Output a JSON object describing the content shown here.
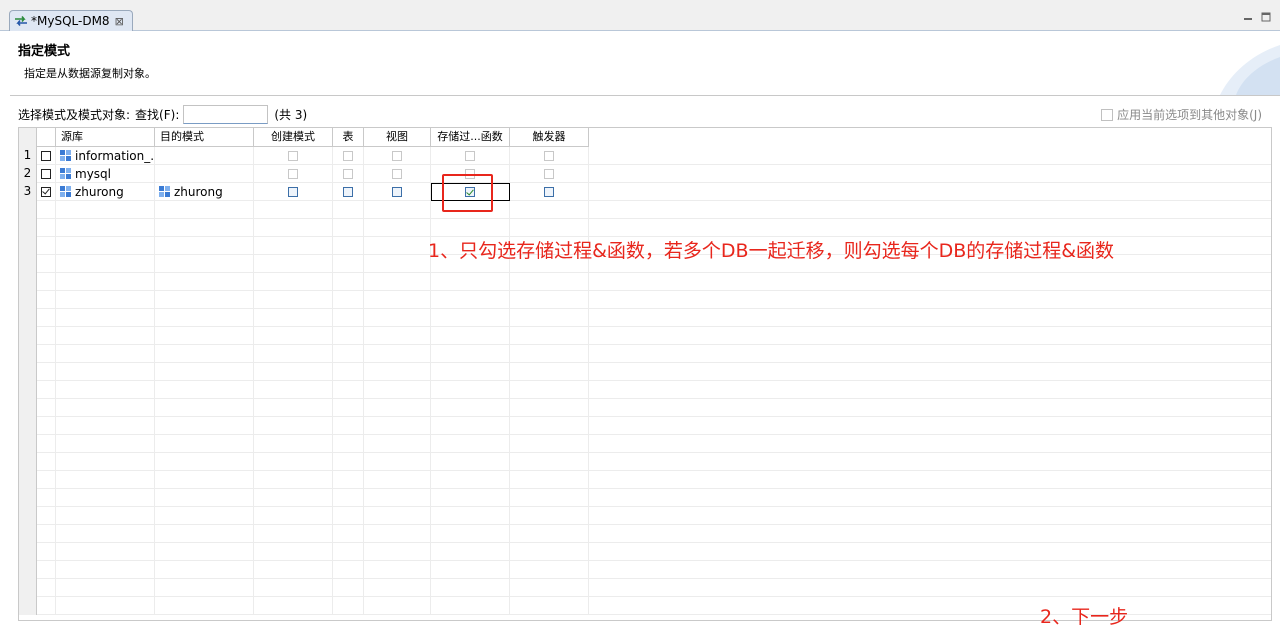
{
  "tab": {
    "title": "*MySQL-DM8",
    "close": "⊠",
    "minimize": "▭",
    "maximize": "▭"
  },
  "header": {
    "title": "指定模式",
    "description": "指定是从数据源复制对象。"
  },
  "toolbar": {
    "select_label": "选择模式及模式对象:",
    "search_label": "查找(F):",
    "search_value": "",
    "count": "(共 3)",
    "apply_all_label": "应用当前选项到其他对象(J)"
  },
  "table": {
    "columns": [
      "",
      "",
      "源库",
      "目的模式",
      "创建模式",
      "表",
      "视图",
      "存储过...函数",
      "触发器"
    ],
    "rows": [
      {
        "num": "1",
        "selected": false,
        "source": "information_..",
        "target": "",
        "create_schema": false,
        "table": false,
        "view": false,
        "procedure": false,
        "trigger": false,
        "enabled": false
      },
      {
        "num": "2",
        "selected": false,
        "source": "mysql",
        "target": "",
        "create_schema": false,
        "table": false,
        "view": false,
        "procedure": false,
        "trigger": false,
        "enabled": false
      },
      {
        "num": "3",
        "selected": true,
        "source": "zhurong",
        "target": "zhurong",
        "create_schema": false,
        "table": false,
        "view": false,
        "procedure": true,
        "trigger": false,
        "enabled": true
      }
    ]
  },
  "annotations": {
    "note1": "1、只勾选存储过程&函数，若多个DB一起迁移，则勾选每个DB的存储过程&函数",
    "note2": "2、下一步"
  },
  "colors": {
    "annotation": "#e8261c",
    "tab_bg": "#dfe7f3",
    "checkbox_enabled": "#3c6fa8"
  },
  "icons": {
    "tab": "sync-arrows-icon",
    "db": "database-schema-icon"
  }
}
